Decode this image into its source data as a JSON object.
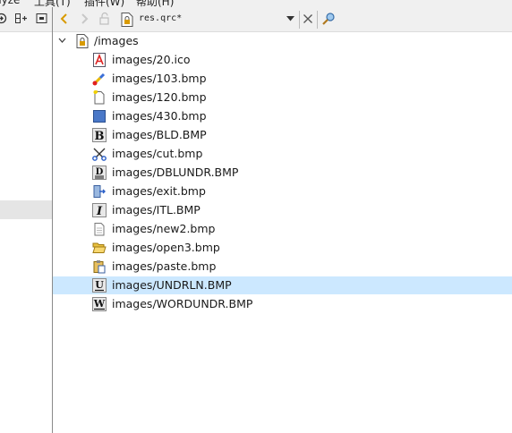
{
  "menubar": {
    "item1": "nyze",
    "item2": "工具(T)",
    "item3": "插件(W)",
    "item4": "帮助(H)"
  },
  "toolbar": {
    "file_name": "res.qrc*"
  },
  "tree": {
    "root_label": "/images",
    "items": [
      {
        "label": "images/20.ico",
        "icon": "ico-file-icon"
      },
      {
        "label": "images/103.bmp",
        "icon": "paint-icon"
      },
      {
        "label": "images/120.bmp",
        "icon": "new-file-icon"
      },
      {
        "label": "images/430.bmp",
        "icon": "blue-square-icon"
      },
      {
        "label": "images/BLD.BMP",
        "icon": "bold-icon"
      },
      {
        "label": "images/cut.bmp",
        "icon": "scissors-icon"
      },
      {
        "label": "images/DBLUNDR.BMP",
        "icon": "double-underline-icon"
      },
      {
        "label": "images/exit.bmp",
        "icon": "exit-icon"
      },
      {
        "label": "images/ITL.BMP",
        "icon": "italic-icon"
      },
      {
        "label": "images/new2.bmp",
        "icon": "document-icon"
      },
      {
        "label": "images/open3.bmp",
        "icon": "folder-open-icon"
      },
      {
        "label": "images/paste.bmp",
        "icon": "paste-icon"
      },
      {
        "label": "images/UNDRLN.BMP",
        "icon": "underline-icon"
      },
      {
        "label": "images/WORDUNDR.BMP",
        "icon": "word-underline-icon"
      }
    ]
  },
  "colors": {
    "selection": "#cce8ff",
    "toolbar_bg": "#f0f0f0",
    "accent_orange": "#d89a00"
  }
}
